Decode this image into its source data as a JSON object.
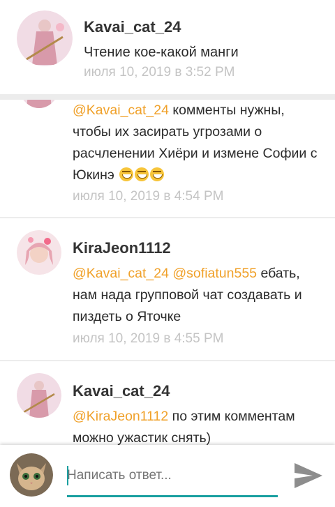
{
  "post": {
    "author": "Kavai_cat_24",
    "title": "Чтение кое-какой манги",
    "timestamp": "июля 10, 2019 в 3:52 PM"
  },
  "comments": [
    {
      "mention": "@Kavai_cat_24",
      "text": " комменты нужны, чтобы их засирать угрозами о расчленении Хиёри и измене Софии с Юкинэ",
      "emoji": "😁😁😁",
      "timestamp": "июля 10, 2019 в 4:54 PM"
    },
    {
      "author": "KiraJeon1112",
      "mention1": "@Kavai_cat_24",
      "mention2": "@sofiatun555",
      "text": " ебать, нам нада групповой чат создавать и пиздеть о Яточке",
      "timestamp": "июля 10, 2019 в 4:55 PM"
    },
    {
      "author": "Kavai_cat_24",
      "mention": "@KiraJeon1112",
      "text": " по этим комментам можно ужастик снять)"
    }
  ],
  "reply": {
    "placeholder": "Написать ответ..."
  }
}
